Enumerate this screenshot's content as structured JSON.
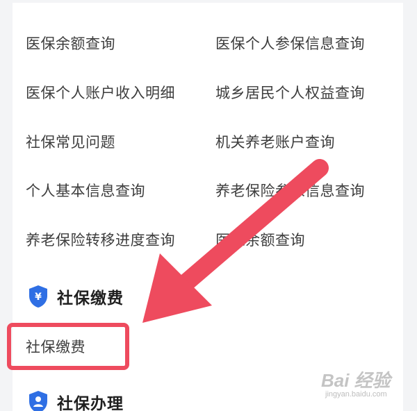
{
  "service_grid": {
    "items": [
      {
        "label": "医保余额查询"
      },
      {
        "label": "医保个人参保信息查询"
      },
      {
        "label": "医保个人账户收入明细"
      },
      {
        "label": "城乡居民个人权益查询"
      },
      {
        "label": "社保常见问题"
      },
      {
        "label": "机关养老账户查询"
      },
      {
        "label": "个人基本信息查询"
      },
      {
        "label": "养老保险参保信息查询"
      },
      {
        "label": "养老保险转移进度查询"
      },
      {
        "label": "医保余额查询"
      }
    ]
  },
  "section_pay": {
    "title": "社保缴费",
    "icon": "yuan-shield-icon",
    "items": [
      {
        "label": "社保缴费"
      }
    ]
  },
  "section_handle": {
    "title": "社保办理",
    "icon": "person-shield-icon"
  },
  "annotation": {
    "color": "#ee4b5e"
  },
  "watermark": {
    "brand": "Bai 经验",
    "url": "jingyan.baidu.com"
  },
  "colors": {
    "accent_blue": "#2f6fe4",
    "text": "#3d3d3d",
    "heading": "#1f1f1f"
  }
}
